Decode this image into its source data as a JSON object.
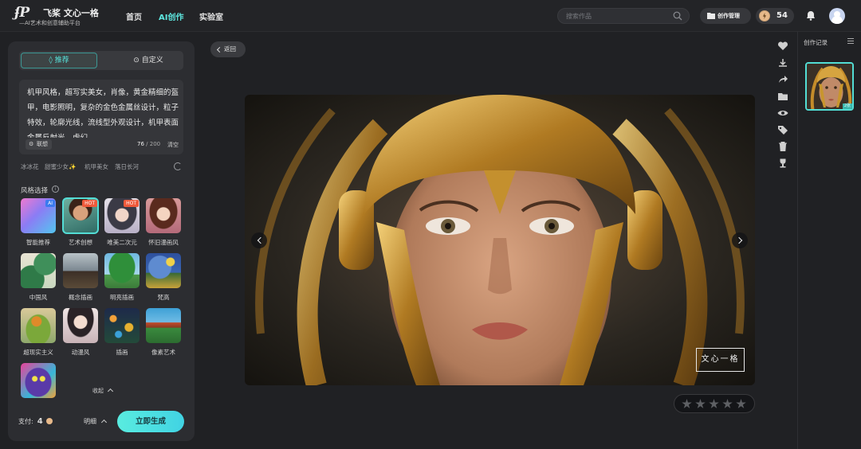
{
  "header": {
    "logo_mark": "ʄP",
    "logo_name": "飞桨 文心一格",
    "logo_sub": "—AI艺术和创意辅助平台",
    "nav": [
      {
        "label": "首页",
        "active": false
      },
      {
        "label": "AI创作",
        "active": true
      },
      {
        "label": "实验室",
        "active": false
      }
    ],
    "search_placeholder": "搜索作品",
    "manage_label": "创作管理",
    "points": "54"
  },
  "left_panel": {
    "tabs": {
      "recommend": "推荐",
      "custom": "自定义"
    },
    "prompt": "机甲风格，超写实美女，肖像，黄金精细的盔甲，电影照明，复杂的金色金属丝设计，粒子特效，轮廓光线，流线型外观设计，机甲表面金属反射光，虚幻",
    "associate_label": "联想",
    "count_current": "76",
    "count_max": "/ 200",
    "clear_label": "清空",
    "suggestions": [
      "冰冰花",
      "甜蜜少女✨",
      "机甲美女",
      "落日长河"
    ],
    "style_title": "风格选择",
    "styles": [
      {
        "label": "智能推荐",
        "badge": "AI"
      },
      {
        "label": "艺术创想",
        "badge": "HOT",
        "selected": true
      },
      {
        "label": "唯美二次元",
        "badge": "HOT"
      },
      {
        "label": "怀旧漫画风",
        "badge": ""
      },
      {
        "label": "中国风",
        "badge": ""
      },
      {
        "label": "概念插画",
        "badge": ""
      },
      {
        "label": "明亮插画",
        "badge": ""
      },
      {
        "label": "梵高",
        "badge": ""
      },
      {
        "label": "超现实主义",
        "badge": ""
      },
      {
        "label": "动漫风",
        "badge": ""
      },
      {
        "label": "插画",
        "badge": ""
      },
      {
        "label": "像素艺术",
        "badge": ""
      },
      {
        "label": "",
        "badge": ""
      }
    ],
    "collapse_label": "收起",
    "pay_label": "支付:",
    "pay_amount": "4",
    "detail_label": "明细",
    "generate_label": "立即生成"
  },
  "center": {
    "back_label": "返回",
    "watermark": "文心一格",
    "rating_value": 0,
    "rating_max": 5
  },
  "toolbar": [
    "heart-icon",
    "download-icon",
    "share-icon",
    "folder-icon",
    "eye-icon",
    "tag-icon",
    "trash-icon",
    "trophy-icon"
  ],
  "history": {
    "title": "创作记录",
    "tag": "2张"
  },
  "colors": {
    "accent": "#53ddd5",
    "background": "#202124",
    "panel": "#2c2d31"
  }
}
